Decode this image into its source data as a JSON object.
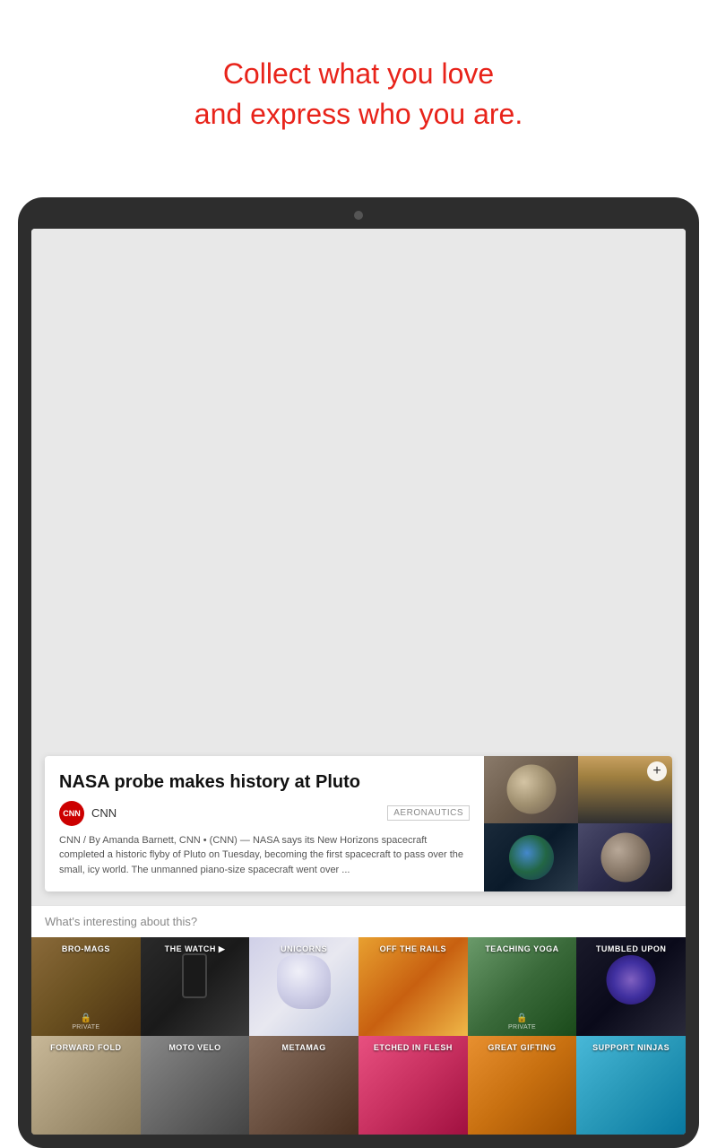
{
  "header": {
    "line1": "Collect what you love",
    "line2": "and express who you are."
  },
  "article": {
    "title": "NASA probe makes history at Pluto",
    "source": "CNN",
    "tag": "AERONAUTICS",
    "body": "CNN / By Amanda Barnett, CNN • (CNN) — NASA says its New Horizons spacecraft completed a historic flyby of Pluto on Tuesday, becoming the first spacecraft to pass over the small, icy world. The unmanned piano-size spacecraft went over ...",
    "plus_button": "+"
  },
  "whats_interesting_label": "What's interesting about this?",
  "collections_row1": [
    {
      "id": "bro-mags",
      "label": "BRO-MAGS",
      "private": true
    },
    {
      "id": "the-watch",
      "label": "THE WATCH ▶",
      "private": false
    },
    {
      "id": "unicorns",
      "label": "UNICORNS",
      "private": false
    },
    {
      "id": "off-the-rails",
      "label": "OFF THE RAILS",
      "private": false
    },
    {
      "id": "teaching-yoga",
      "label": "TEACHING YOGA",
      "private": true
    },
    {
      "id": "tumbled-upon",
      "label": "TUMBLED UPON",
      "private": false
    }
  ],
  "collections_row2": [
    {
      "id": "forward-fold",
      "label": "FORWARD FOLD",
      "private": false
    },
    {
      "id": "moto-velo",
      "label": "MOTO VELO",
      "private": false
    },
    {
      "id": "metamag",
      "label": "METAMAG",
      "private": false
    },
    {
      "id": "etched-in-flesh",
      "label": "ETCHED IN FLESH",
      "private": false
    },
    {
      "id": "great-gifting",
      "label": "GREAT GIFTING",
      "private": false
    },
    {
      "id": "support-ninjas",
      "label": "SUPPORT NINJAS",
      "private": false
    }
  ]
}
